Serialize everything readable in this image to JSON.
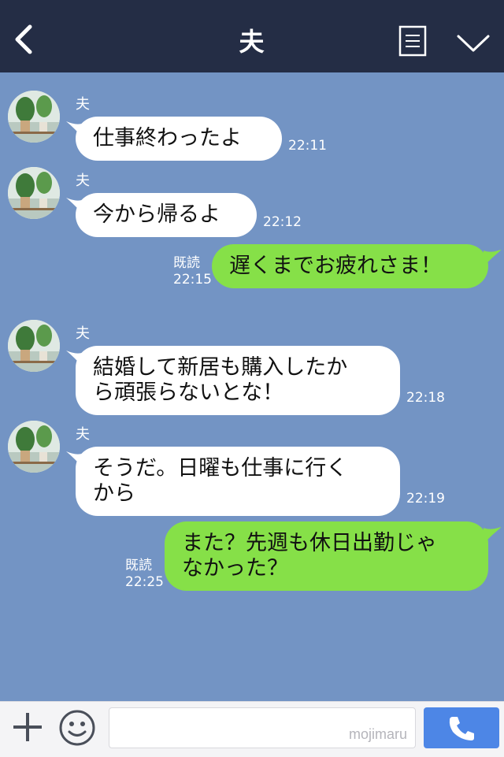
{
  "header": {
    "title": "夫",
    "icons": [
      "back-icon",
      "menu-icon",
      "chevron-down-icon"
    ],
    "colors": {
      "background": "#242d45",
      "text": "#ffffff"
    }
  },
  "chat": {
    "background": "#7394c4",
    "messages": [
      {
        "direction": "in",
        "sender": "夫",
        "text": "仕事終わったよ",
        "time": "22:11"
      },
      {
        "direction": "in",
        "sender": "夫",
        "text": "今から帰るよ",
        "time": "22:12"
      },
      {
        "direction": "out",
        "text": "遅くまでお疲れさま！",
        "read": "既読",
        "time": "22:15"
      },
      {
        "direction": "in",
        "sender": "夫",
        "text": "結婚して新居も購入したか\nら頑張らないとな！",
        "time": "22:18"
      },
      {
        "direction": "in",
        "sender": "夫",
        "text": "そうだ。日曜も仕事に行く\nから",
        "time": "22:19"
      },
      {
        "direction": "out",
        "text": "また？先週も休日出勤じゃ\nなかった？",
        "read": "既読",
        "time": "22:25"
      }
    ],
    "colors": {
      "incoming": "#ffffff",
      "outgoing": "#86e048"
    }
  },
  "footer": {
    "icons": [
      "plus-icon",
      "smile-icon",
      "phone-icon"
    ],
    "input_value": "",
    "watermark": "mojimaru",
    "colors": {
      "call_button": "#4d86e6"
    }
  }
}
